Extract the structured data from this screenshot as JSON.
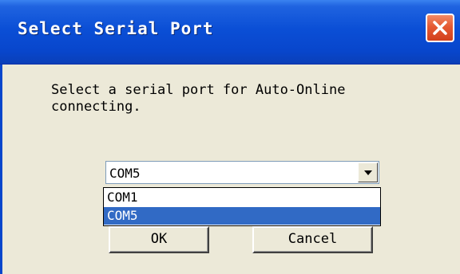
{
  "window": {
    "title": "Select Serial Port",
    "close_icon": "close-icon"
  },
  "dialog": {
    "message": "Select a serial port for Auto-Online\nconnecting.",
    "combo": {
      "selected_value": "COM5",
      "options": [
        "COM1",
        "COM5"
      ],
      "highlighted": "COM5"
    },
    "buttons": {
      "ok_label": "OK",
      "cancel_label": "Cancel"
    }
  },
  "colors": {
    "titlebar": "#0846cc",
    "client_bg": "#ece9d8",
    "selection": "#316ac5",
    "close_button": "#e55a33"
  }
}
